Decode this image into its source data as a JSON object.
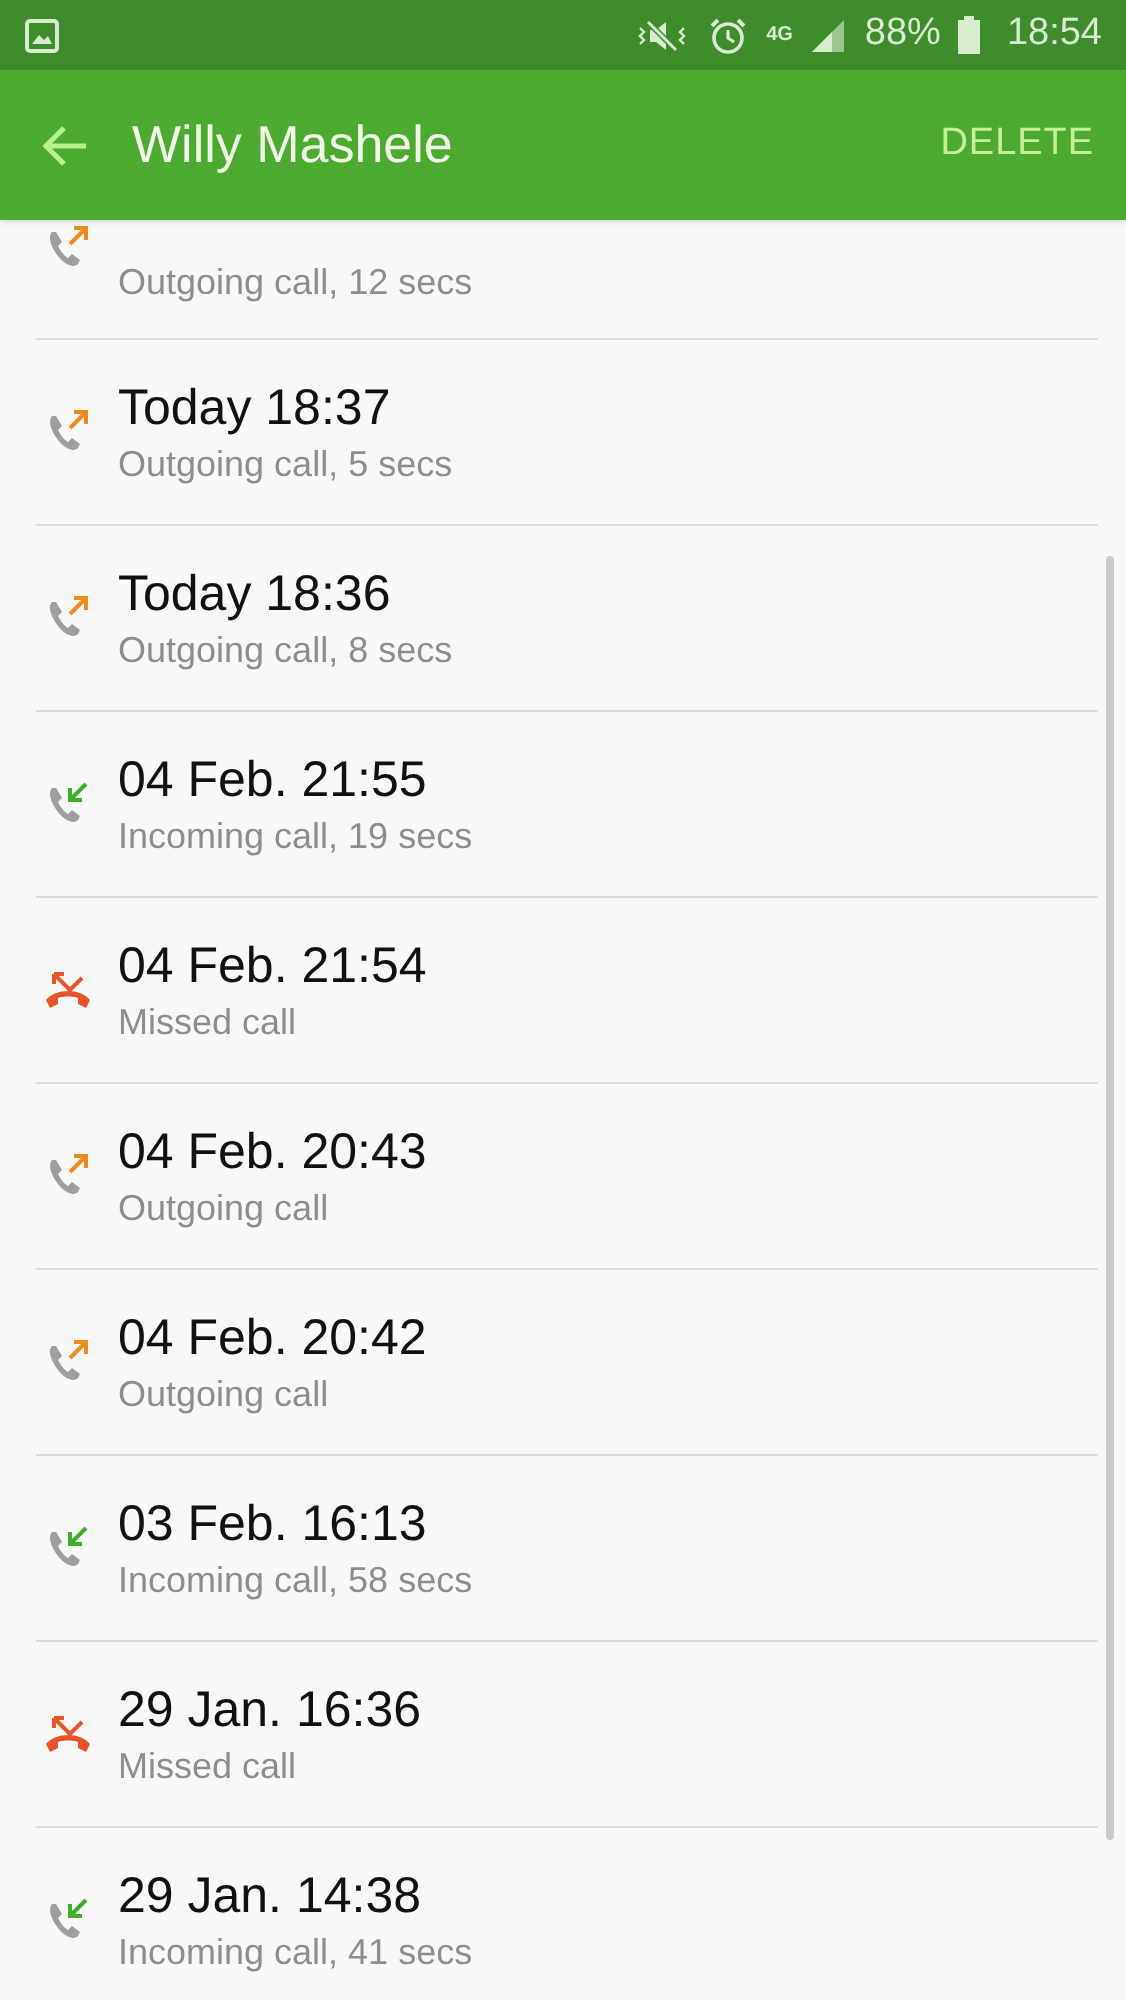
{
  "status_bar": {
    "network": "4G",
    "battery": "88%",
    "time": "18:54"
  },
  "app_bar": {
    "title": "Willy Mashele",
    "action": "DELETE"
  },
  "calls": [
    {
      "kind": "outgoing",
      "detail": "Outgoing call, 12 secs"
    },
    {
      "kind": "outgoing",
      "title": "Today 18:37",
      "detail": "Outgoing call, 5 secs"
    },
    {
      "kind": "outgoing",
      "title": "Today 18:36",
      "detail": "Outgoing call, 8 secs"
    },
    {
      "kind": "incoming",
      "title": "04 Feb. 21:55",
      "detail": "Incoming call, 19 secs"
    },
    {
      "kind": "missed",
      "title": "04 Feb. 21:54",
      "detail": "Missed call"
    },
    {
      "kind": "outgoing",
      "title": "04 Feb. 20:43",
      "detail": "Outgoing call"
    },
    {
      "kind": "outgoing",
      "title": "04 Feb. 20:42",
      "detail": "Outgoing call"
    },
    {
      "kind": "incoming",
      "title": "03 Feb. 16:13",
      "detail": "Incoming call, 58 secs"
    },
    {
      "kind": "missed",
      "title": "29 Jan. 16:36",
      "detail": "Missed call"
    },
    {
      "kind": "incoming",
      "title": "29 Jan. 14:38",
      "detail": "Incoming call, 41 secs"
    }
  ]
}
